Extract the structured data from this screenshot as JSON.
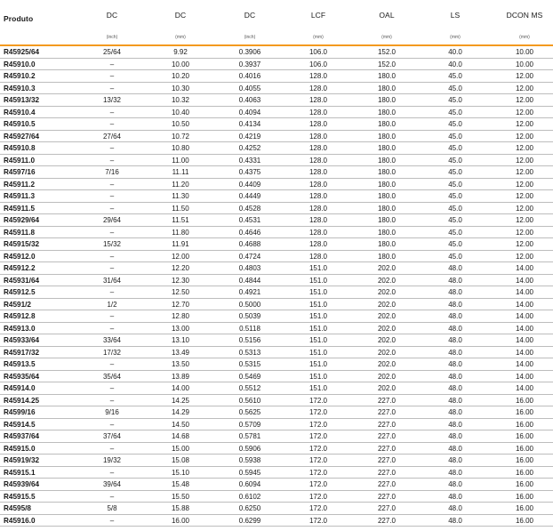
{
  "columns": [
    {
      "title": "Produto",
      "unit": ""
    },
    {
      "title": "DC",
      "unit": "(inch)"
    },
    {
      "title": "DC",
      "unit": "(mm)"
    },
    {
      "title": "DC",
      "unit": "(inch)"
    },
    {
      "title": "LCF",
      "unit": "(mm)"
    },
    {
      "title": "OAL",
      "unit": "(mm)"
    },
    {
      "title": "LS",
      "unit": "(mm)"
    },
    {
      "title": "DCON MS",
      "unit": "(mm)"
    }
  ],
  "rows": [
    [
      "R45925/64",
      "25/64",
      "9.92",
      "0.3906",
      "106.0",
      "152.0",
      "40.0",
      "10.00"
    ],
    [
      "R45910.0",
      "–",
      "10.00",
      "0.3937",
      "106.0",
      "152.0",
      "40.0",
      "10.00"
    ],
    [
      "R45910.2",
      "–",
      "10.20",
      "0.4016",
      "128.0",
      "180.0",
      "45.0",
      "12.00"
    ],
    [
      "R45910.3",
      "–",
      "10.30",
      "0.4055",
      "128.0",
      "180.0",
      "45.0",
      "12.00"
    ],
    [
      "R45913/32",
      "13/32",
      "10.32",
      "0.4063",
      "128.0",
      "180.0",
      "45.0",
      "12.00"
    ],
    [
      "R45910.4",
      "–",
      "10.40",
      "0.4094",
      "128.0",
      "180.0",
      "45.0",
      "12.00"
    ],
    [
      "R45910.5",
      "–",
      "10.50",
      "0.4134",
      "128.0",
      "180.0",
      "45.0",
      "12.00"
    ],
    [
      "R45927/64",
      "27/64",
      "10.72",
      "0.4219",
      "128.0",
      "180.0",
      "45.0",
      "12.00"
    ],
    [
      "R45910.8",
      "–",
      "10.80",
      "0.4252",
      "128.0",
      "180.0",
      "45.0",
      "12.00"
    ],
    [
      "R45911.0",
      "–",
      "11.00",
      "0.4331",
      "128.0",
      "180.0",
      "45.0",
      "12.00"
    ],
    [
      "R4597/16",
      "7/16",
      "11.11",
      "0.4375",
      "128.0",
      "180.0",
      "45.0",
      "12.00"
    ],
    [
      "R45911.2",
      "–",
      "11.20",
      "0.4409",
      "128.0",
      "180.0",
      "45.0",
      "12.00"
    ],
    [
      "R45911.3",
      "–",
      "11.30",
      "0.4449",
      "128.0",
      "180.0",
      "45.0",
      "12.00"
    ],
    [
      "R45911.5",
      "–",
      "11.50",
      "0.4528",
      "128.0",
      "180.0",
      "45.0",
      "12.00"
    ],
    [
      "R45929/64",
      "29/64",
      "11.51",
      "0.4531",
      "128.0",
      "180.0",
      "45.0",
      "12.00"
    ],
    [
      "R45911.8",
      "–",
      "11.80",
      "0.4646",
      "128.0",
      "180.0",
      "45.0",
      "12.00"
    ],
    [
      "R45915/32",
      "15/32",
      "11.91",
      "0.4688",
      "128.0",
      "180.0",
      "45.0",
      "12.00"
    ],
    [
      "R45912.0",
      "–",
      "12.00",
      "0.4724",
      "128.0",
      "180.0",
      "45.0",
      "12.00"
    ],
    [
      "R45912.2",
      "–",
      "12.20",
      "0.4803",
      "151.0",
      "202.0",
      "48.0",
      "14.00"
    ],
    [
      "R45931/64",
      "31/64",
      "12.30",
      "0.4844",
      "151.0",
      "202.0",
      "48.0",
      "14.00"
    ],
    [
      "R45912.5",
      "–",
      "12.50",
      "0.4921",
      "151.0",
      "202.0",
      "48.0",
      "14.00"
    ],
    [
      "R4591/2",
      "1/2",
      "12.70",
      "0.5000",
      "151.0",
      "202.0",
      "48.0",
      "14.00"
    ],
    [
      "R45912.8",
      "–",
      "12.80",
      "0.5039",
      "151.0",
      "202.0",
      "48.0",
      "14.00"
    ],
    [
      "R45913.0",
      "–",
      "13.00",
      "0.5118",
      "151.0",
      "202.0",
      "48.0",
      "14.00"
    ],
    [
      "R45933/64",
      "33/64",
      "13.10",
      "0.5156",
      "151.0",
      "202.0",
      "48.0",
      "14.00"
    ],
    [
      "R45917/32",
      "17/32",
      "13.49",
      "0.5313",
      "151.0",
      "202.0",
      "48.0",
      "14.00"
    ],
    [
      "R45913.5",
      "–",
      "13.50",
      "0.5315",
      "151.0",
      "202.0",
      "48.0",
      "14.00"
    ],
    [
      "R45935/64",
      "35/64",
      "13.89",
      "0.5469",
      "151.0",
      "202.0",
      "48.0",
      "14.00"
    ],
    [
      "R45914.0",
      "–",
      "14.00",
      "0.5512",
      "151.0",
      "202.0",
      "48.0",
      "14.00"
    ],
    [
      "R45914.25",
      "–",
      "14.25",
      "0.5610",
      "172.0",
      "227.0",
      "48.0",
      "16.00"
    ],
    [
      "R4599/16",
      "9/16",
      "14.29",
      "0.5625",
      "172.0",
      "227.0",
      "48.0",
      "16.00"
    ],
    [
      "R45914.5",
      "–",
      "14.50",
      "0.5709",
      "172.0",
      "227.0",
      "48.0",
      "16.00"
    ],
    [
      "R45937/64",
      "37/64",
      "14.68",
      "0.5781",
      "172.0",
      "227.0",
      "48.0",
      "16.00"
    ],
    [
      "R45915.0",
      "–",
      "15.00",
      "0.5906",
      "172.0",
      "227.0",
      "48.0",
      "16.00"
    ],
    [
      "R45919/32",
      "19/32",
      "15.08",
      "0.5938",
      "172.0",
      "227.0",
      "48.0",
      "16.00"
    ],
    [
      "R45915.1",
      "–",
      "15.10",
      "0.5945",
      "172.0",
      "227.0",
      "48.0",
      "16.00"
    ],
    [
      "R45939/64",
      "39/64",
      "15.48",
      "0.6094",
      "172.0",
      "227.0",
      "48.0",
      "16.00"
    ],
    [
      "R45915.5",
      "–",
      "15.50",
      "0.6102",
      "172.0",
      "227.0",
      "48.0",
      "16.00"
    ],
    [
      "R4595/8",
      "5/8",
      "15.88",
      "0.6250",
      "172.0",
      "227.0",
      "48.0",
      "16.00"
    ],
    [
      "R45916.0",
      "–",
      "16.00",
      "0.6299",
      "172.0",
      "227.0",
      "48.0",
      "16.00"
    ]
  ]
}
